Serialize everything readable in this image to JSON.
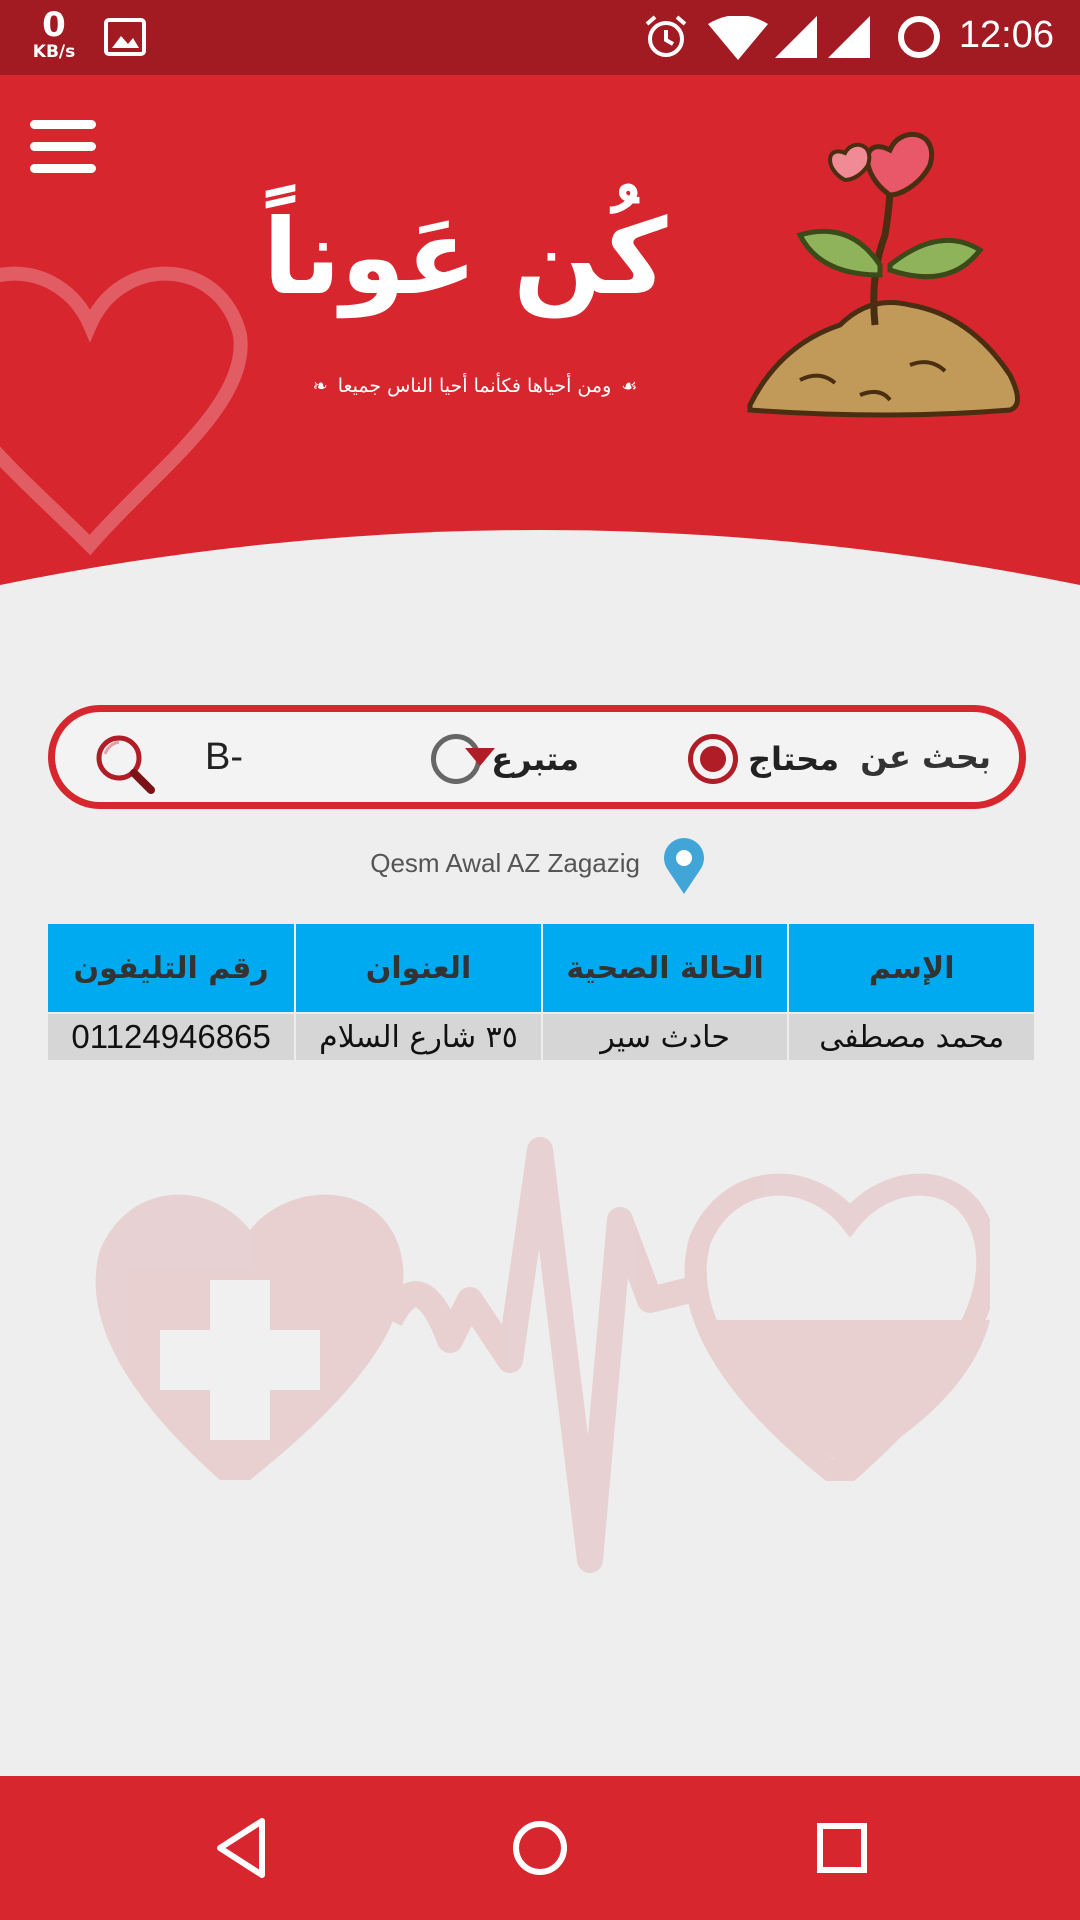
{
  "status_bar": {
    "speed_value": "0",
    "speed_unit": "KB/s",
    "time": "12:06",
    "icons": [
      "image-icon",
      "alarm-icon",
      "wifi-icon",
      "signal-icon",
      "signal-icon",
      "sync-circle-icon"
    ]
  },
  "header": {
    "logo_text": "كُن عَوناً",
    "tagline": "ومن أحياها فكأنما أحيا الناس جميعا",
    "menu_icon": "hamburger-menu-icon",
    "illustration": "heart-plant-icon"
  },
  "search": {
    "label": "بحث عن",
    "options": [
      {
        "label": "محتاج",
        "checked": true
      },
      {
        "label": "متبرع",
        "checked": false
      }
    ],
    "blood_type": "B-",
    "dropdown_icon": "dropdown-arrow-icon",
    "search_icon": "magnifier-icon"
  },
  "location": {
    "text": "Qesm Awal AZ Zagazig",
    "icon": "map-pin-icon"
  },
  "table": {
    "headers": [
      "الإسم",
      "الحالة الصحية",
      "العنوان",
      "رقم التليفون"
    ],
    "rows": [
      [
        "محمد مصطفى",
        "حادث سير",
        "٣٥ شارع السلام",
        "01124946865"
      ]
    ]
  },
  "colors": {
    "primary_red": "#d8262f",
    "status_bar_red": "#a31b22",
    "table_header_blue": "#00aaf0"
  },
  "nav_bar": {
    "buttons": [
      "back-icon",
      "home-icon",
      "recents-icon"
    ]
  }
}
